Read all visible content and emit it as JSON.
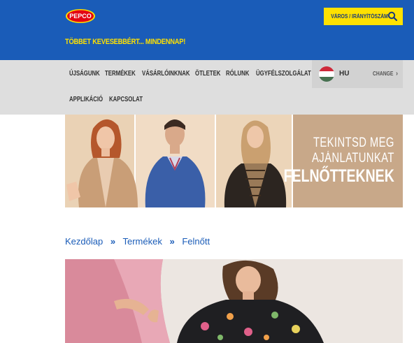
{
  "header": {
    "logo_text": "PEPCO",
    "tagline": "TÖBBET KEVESEBBÉRT... MINDENNAP!",
    "search_label": "VÁROS / IRÁNYÍTÓSZÁM",
    "search_icon": "search-icon",
    "colors": {
      "background": "#1a5cb8",
      "accent": "#ffe100",
      "logo_red": "#e30613"
    }
  },
  "nav": {
    "items": [
      "ÚJSÁGUNK",
      "TERMÉKEK",
      "VÁSÁRLÓINKNAK",
      "ÖTLETEK",
      "RÓLUNK",
      "ÜGYFÉLSZOLGÁLAT"
    ],
    "items_row2": [
      "APPLIKÁCIÓ",
      "KAPCSOLAT"
    ],
    "language": {
      "code": "HU",
      "change_label": "CHANGE",
      "flag_icon": "hungary-flag-icon"
    }
  },
  "banner": {
    "line1": "TEKINTSD MEG",
    "line2": "AJÁNLATUNKAT",
    "line3": "FELNŐTTEKNEK"
  },
  "breadcrumb": {
    "items": [
      "Kezdőlap",
      "Termékek",
      "Felnőtt"
    ],
    "separator": "»"
  }
}
